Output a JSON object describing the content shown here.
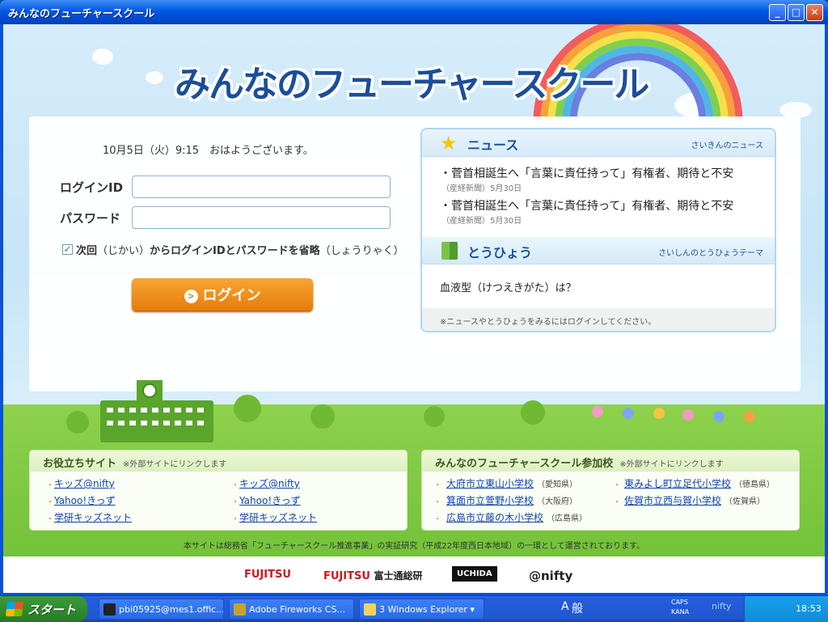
{
  "window": {
    "title": "みんなのフューチャースクール",
    "min": "_",
    "max": "□",
    "close": "✕"
  },
  "site": {
    "logo": "みんなのフューチャースクール"
  },
  "login": {
    "datetime": "10月5日（火）9:15　おはようございます。",
    "id_label": "ログインID",
    "id_value": "",
    "password_label": "パスワード",
    "password_value": "",
    "remember_checked": true,
    "remember_label_prefix": "次回",
    "remember_label_ruby1": "（じかい）",
    "remember_label_mid": "からログインIDとパスワードを省略",
    "remember_label_ruby2": "（しょうりゃく）",
    "button_label": "ログイン"
  },
  "news": {
    "title": "ニュース",
    "subtitle": "さいきんのニュース",
    "items": [
      {
        "headline": "菅首相誕生へ「言葉に責任持って」有権者、期待と不安",
        "source": "（産経新聞）5月30日"
      },
      {
        "headline": "菅首相誕生へ「言葉に責任持って」有権者、期待と不安",
        "source": "（産経新聞）5月30日"
      }
    ]
  },
  "poll": {
    "title": "とうひょう",
    "subtitle": "さいしんのとうひょうテーマ",
    "question": "血液型（けつえきがた）は？",
    "note": "※ニュースやとうひょうをみるにはログインしてください。"
  },
  "useful_sites": {
    "title": "お役立ちサイト",
    "note": "※外部サイトにリンクします",
    "col1": [
      "キッズ@nifty",
      "Yahoo!きっず",
      "学研キッズネット"
    ],
    "col2": [
      "キッズ@nifty",
      "Yahoo!きっず",
      "学研キッズネット"
    ]
  },
  "schools": {
    "title": "みんなのフューチャースクール参加校",
    "note": "※外部サイトにリンクします",
    "col1": [
      {
        "name": "大府市立東山小学校",
        "pref": "（愛知県）"
      },
      {
        "name": "箕面市立萱野小学校",
        "pref": "（大阪府）"
      },
      {
        "name": "広島市立藤の木小学校",
        "pref": "（広島県）"
      }
    ],
    "col2": [
      {
        "name": "東みよし町立足代小学校",
        "pref": "（徳島県）"
      },
      {
        "name": "佐賀市立西与賀小学校",
        "pref": "（佐賀県）"
      }
    ]
  },
  "footer": {
    "note": "本サイトは総務省「フューチャースクール推進事業」の実証研究（平成22年度西日本地域）の一環として運営されております。",
    "sponsors": [
      "FUJITSU",
      "FUJITSU",
      "富士通総研",
      "UCHIDA",
      "@nifty"
    ]
  },
  "taskbar": {
    "start": "スタート",
    "tasks": [
      "pbi05925@mes1.offic...",
      "Adobe Fireworks CS...",
      "3 Windows Explorer"
    ],
    "ime": [
      "A",
      "般",
      "CAPS",
      "KANA",
      "nifty"
    ],
    "clock": "18:53"
  },
  "colors": {
    "accent": "#1b4e9a",
    "button": "#f29219",
    "link": "#1144aa",
    "taskbar": "#245ddb",
    "start": "#2f8a2c"
  }
}
